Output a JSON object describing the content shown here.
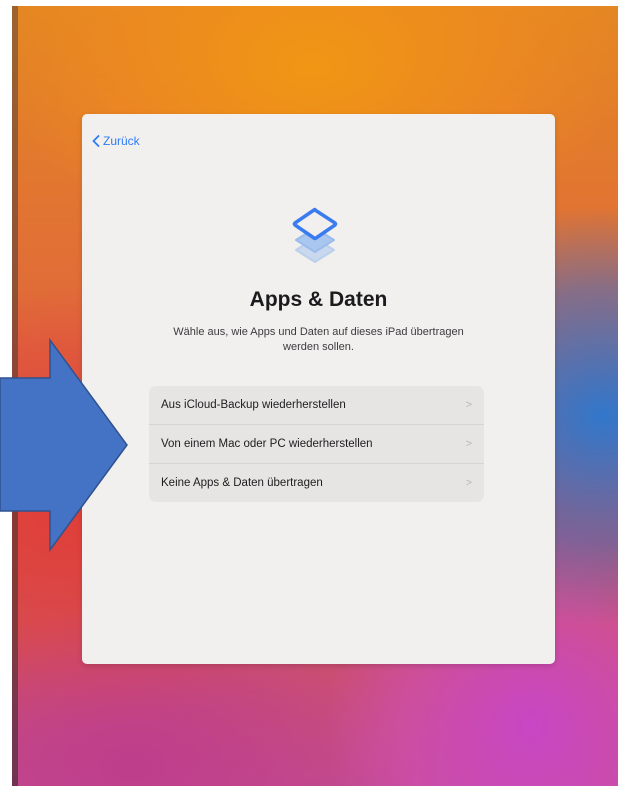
{
  "nav": {
    "back_label": "Zurück"
  },
  "header": {
    "title": "Apps & Daten",
    "subtitle": "Wähle aus, wie Apps und Daten auf dieses iPad übertragen werden sollen."
  },
  "options": [
    {
      "label": "Aus iCloud-Backup wiederherstellen",
      "icon": "chevron-right-icon"
    },
    {
      "label": "Von einem Mac oder PC wiederherstellen",
      "icon": "chevron-right-icon"
    },
    {
      "label": "Keine Apps & Daten übertragen",
      "icon": "chevron-right-icon"
    }
  ],
  "annotation": {
    "icon": "arrow-right-icon",
    "color": "#4472c4",
    "border_color": "#2f528f"
  },
  "colors": {
    "accent": "#2f7bf6",
    "panel": "#f1f0ef"
  }
}
